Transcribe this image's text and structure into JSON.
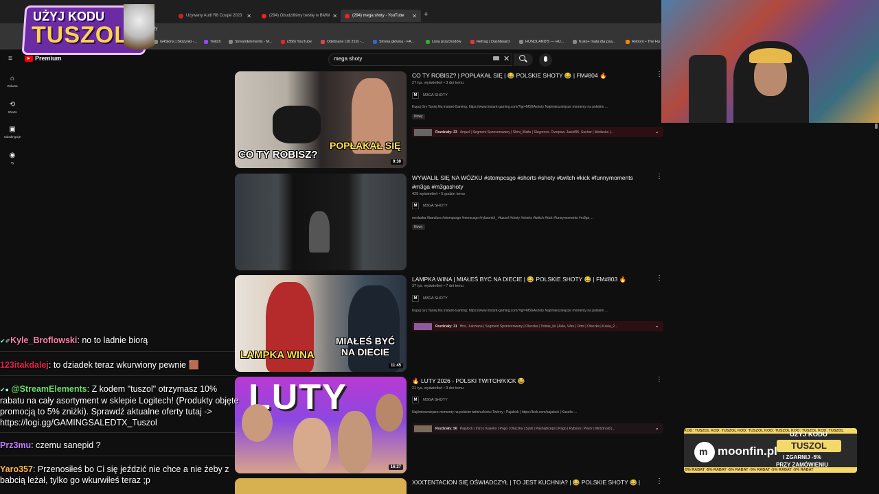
{
  "browser": {
    "tabs": [
      {
        "label": "Używany Audi R8 Coupé 2023"
      },
      {
        "label": "(294) Obudziliśmy bestię w BMW"
      },
      {
        "label": "(294) mega shoty - YouTube"
      }
    ],
    "url_fragment": "shoty",
    "bookmarks": [
      "G4Skins | Skrzynki -...",
      "Twitch",
      "StreamElements - M...",
      "(356) YouTube",
      "Odebrane (10 219) -...",
      "Strona główna - FA...",
      "Lista przychodów",
      "Refrag | Dashboard",
      "HUNDLAND'S — HU...",
      "Kuko+ mata dla psa...",
      "Reborn • The Hu"
    ]
  },
  "youtube": {
    "logo_label": "Premium",
    "search_value": "mega shoty",
    "sidebar": [
      {
        "label": "Główna",
        "icon": "home-icon"
      },
      {
        "label": "Shorts",
        "icon": "shorts-icon"
      },
      {
        "label": "Subskrypcje",
        "icon": "subscriptions-icon"
      },
      {
        "label": "Ty",
        "icon": "you-icon"
      }
    ],
    "videos": [
      {
        "title": "CO TY ROBISZ? | POPŁAKAŁ SIĘ | 😂 POLSKIE SHOTY 😂 | FM#804 🔥",
        "meta": "27 tys. wyświetleń • 3 dni temu",
        "channel": "M3GA SHOTY",
        "desc": "Kupuj Gry Taniej Na Instant-Gaming: https://www.instant-gaming.com/?igr=M3GAshoty Najśmieszniejsze momenty na polskim ...",
        "badge": "Nowy",
        "chapters_label": "Rozdziały: 23",
        "chapters_text": "Arquel | Segment Sponsorowany | Shini_Waifu | Slayproxx, Overpow, Jasiof95, Suchar | Meduska |...",
        "duration": "9:30",
        "thumb_text_1": "CO TY ROBISZ?",
        "thumb_text_2": "POPŁAKAŁ SIĘ"
      },
      {
        "title": "WYWALIŁ SIĘ NA WÓZKU #stompcsgo #shorts #shoty #twitch #kick #funnymoments #m3ga #m3gashoty",
        "meta": "429 wyświetleń • 5 godzin temu",
        "channel": "M3GA SHOTY",
        "desc": "meduska #bandura #stompcsgo #neexcsgo #rybsonlol_ #tuszol #shoty #shorts #twitch #kick #funnymoments #m3ga ...",
        "badge": "Nowy"
      },
      {
        "title": "LAMPKA WINA | MIAŁEŚ BYĆ NA DIECIE | 😂 POLSKIE SHOTY 😂 | FM#803 🔥",
        "meta": "37 tys. wyświetleń • 7 dni temu",
        "channel": "M3GA SHOTY",
        "desc": "Kupuj Gry Taniej Na Instant-Gaming: https://www.instant-gaming.com/?igr=M3GAshoty Najśmieszniejsze momenty na polskim ...",
        "chapters_label": "Rozdziały: 31",
        "chapters_text": "Hiro, Julcziana | Segment Sponsorowany | Olaczka | Tobias_lol | Axla, V4ru | Ortis | Olaczka | Kasia_2...",
        "duration": "11:45",
        "thumb_text_1": "LAMPKA WINA",
        "thumb_text_2": "MIAŁEŚ BYĆ NA DIECIE"
      },
      {
        "title": "🔥 LUTY 2026 - POLSKI TWITCH/KICK 😂",
        "meta": "21 tys. wyświetleń • 9 dni temu",
        "channel": "M3GA SHOTY",
        "desc": "Najśmieszniejsze momenty na polskim twitchu/kicku Twórcy : Pajalock | https://kick.com/pajalock | Kaseko ...",
        "chapters_label": "Rozdziały: 56",
        "chapters_text": "Pajalock | Intro | Kaseko | Pago | Olaczka | Szeli | Pashabiceps | Pago | Rybson | Pevor | Mrdzinold |...",
        "duration": "16:27",
        "thumb_text_1": "LUTY"
      },
      {
        "title": "XXXTENTACION SIĘ OŚWIADCZYŁ | TO JEST KUCHNIA? | 😂 POLSKIE SHOTY 😂 |"
      }
    ]
  },
  "overlay": {
    "promo_line1": "UŻYJ KODU",
    "promo_line2": "TUSZOL"
  },
  "chat": [
    {
      "user": "Kyle_Broflowski",
      "msg": "no to ladnie biorą",
      "color": "#ff7fa8"
    },
    {
      "user": "123itakdalej",
      "msg": "to dziadek teraz wkurwiony pewnie 🟫",
      "color": "#e0204a"
    },
    {
      "user": "@StreamElements",
      "msg": "Z kodem \"tuszol\" otrzymasz 10% rabatu na cały asortyment w sklepie Logitech! (Produkty objęte promocją to 5% zniżki). Sprawdź aktualne oferty tutaj -> https://logi.gg/GAMINGSALEDTX_Tuszol",
      "color": "#6fe06f"
    },
    {
      "user": "Prz3mu",
      "msg": "czemu sanepid ?",
      "color": "#c27cff"
    },
    {
      "user": "Yaro357",
      "msg": "Przenosiłeś bo Ci się jeździć nie chce a nie żeby z babcią leżał, tylko go wkurwiłeś teraz ;p",
      "color": "#ffb84a"
    }
  ],
  "moonfin": {
    "strip_text": "KOD: TUSZOL KOD: TUSZOL KOD: TUSZOL KOD: TUSZOL KOD: TUSZOL KOD: TUSZOL",
    "strip_bottom": "-5% RABAT -5% RABAT -5% RABAT -5% RABAT -5% RABAT -5% RABAT",
    "name": "moonfin.pl",
    "line1": "UŻYJ KODU",
    "code": "TUSZOL",
    "line3": "I ZGARNIJ -5%",
    "line4": "PRZY ZAMÓWIENIU"
  },
  "colors": {
    "background": "#0f0f0f",
    "yt_red": "#ff0000",
    "chapter_red": "#2b0f12",
    "promo_purple": "#6a2ba5",
    "moonfin_yellow": "#f5d86a"
  }
}
